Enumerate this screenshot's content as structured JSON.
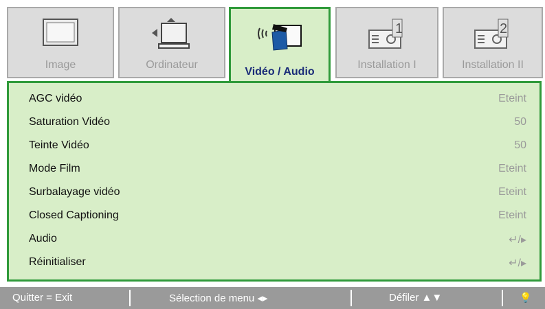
{
  "tabs": [
    {
      "label": "Image",
      "icon": "monitor-icon",
      "active": false
    },
    {
      "label": "Ordinateur",
      "icon": "computer-icon",
      "active": false
    },
    {
      "label": "Vidéo / Audio",
      "icon": "video-audio-icon",
      "active": true
    },
    {
      "label": "Installation I",
      "icon": "projector-1-icon",
      "active": false
    },
    {
      "label": "Installation II",
      "icon": "projector-2-icon",
      "active": false
    }
  ],
  "menu": {
    "items": [
      {
        "name": "AGC vidéo",
        "value": "Eteint"
      },
      {
        "name": "Saturation Vidéo",
        "value": "50"
      },
      {
        "name": "Teinte Vidéo",
        "value": "50"
      },
      {
        "name": "Mode Film",
        "value": "Eteint"
      },
      {
        "name": "Surbalayage vidéo",
        "value": "Eteint"
      },
      {
        "name": "Closed Captioning",
        "value": "Eteint"
      },
      {
        "name": "Audio",
        "value": "↵/▸"
      },
      {
        "name": "Réinitialiser",
        "value": "↵/▸"
      }
    ]
  },
  "statusbar": {
    "quit": "Quitter = Exit",
    "select": "Sélection de menu ◂▸",
    "scroll": "Défiler ▲▼",
    "bulb": "💡"
  },
  "colors": {
    "panel_bg": "#d8eec8",
    "border_green": "#2f9a3a",
    "active_label": "#1a2c78",
    "inactive_label": "#9a9a9a",
    "statusbar_bg": "#9a9a9a"
  }
}
